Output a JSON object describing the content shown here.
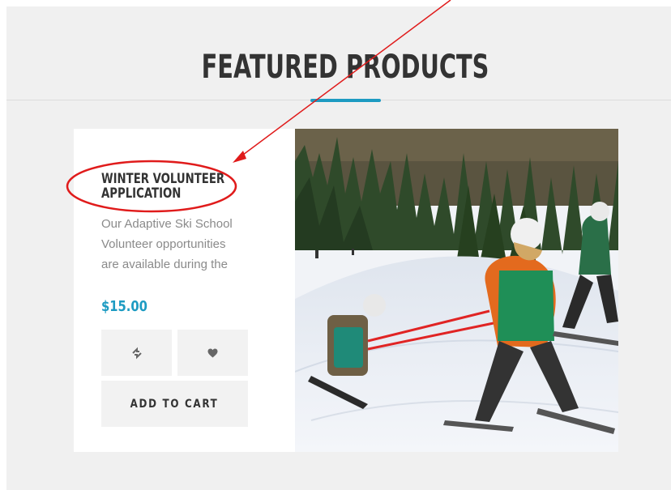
{
  "section": {
    "title": "FEATURED PRODUCTS"
  },
  "product": {
    "name_line1": "WINTER VOLUNTEER",
    "name_line2": "APPLICATION",
    "description_lines": [
      "Our Adaptive Ski School",
      "Volunteer opportunities",
      "are available during the"
    ],
    "price": "$15.00",
    "add_to_cart_label": "ADD TO CART",
    "compare_icon": "compare-arrows-icon",
    "wishlist_icon": "heart-icon"
  },
  "colors": {
    "accent": "#1d9bc2",
    "annotation": "#e01b1b",
    "section_background": "#f0f0f0"
  }
}
